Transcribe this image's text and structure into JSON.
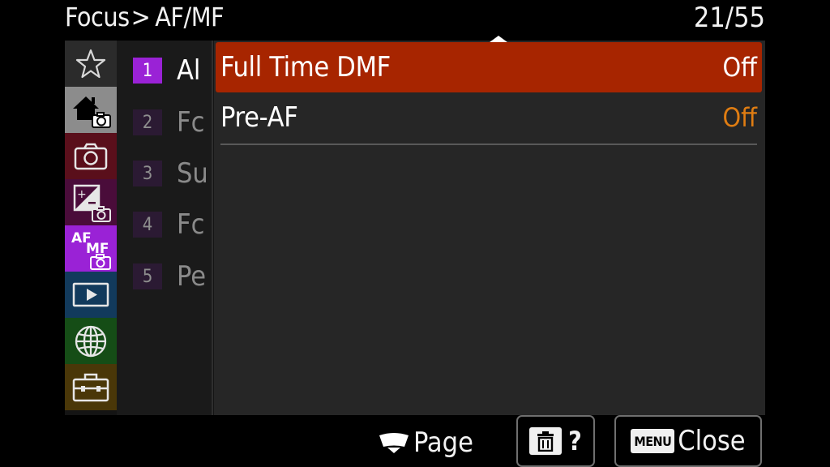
{
  "header": {
    "breadcrumb_parent": "Focus",
    "breadcrumb_separator": ">",
    "breadcrumb_current": "AF/MF",
    "page_counter": "21/55"
  },
  "categories": [
    {
      "icon": "star-icon",
      "color": "#2b2b2b",
      "selected": false
    },
    {
      "icon": "home-camera-icon",
      "color": "#8c8c8c",
      "selected": false
    },
    {
      "icon": "camera-icon",
      "color": "#5a0f1b",
      "selected": false
    },
    {
      "icon": "exposure-camera-icon",
      "color": "#4a0c3a",
      "selected": false
    },
    {
      "icon": "af-mf-camera-icon",
      "color": "#9a22d6",
      "selected": true,
      "label_af": "AF",
      "label_mf": "MF"
    },
    {
      "icon": "playback-icon",
      "color": "#123a5c",
      "selected": false
    },
    {
      "icon": "globe-icon",
      "color": "#154d16",
      "selected": false
    },
    {
      "icon": "toolbox-icon",
      "color": "#4a3708",
      "selected": false
    }
  ],
  "submenu": [
    {
      "number": "1",
      "label": "Al",
      "active": true
    },
    {
      "number": "2",
      "label": "Fc",
      "active": false
    },
    {
      "number": "3",
      "label": "Su",
      "active": false
    },
    {
      "number": "4",
      "label": "Fc",
      "active": false
    },
    {
      "number": "5",
      "label": "Pe",
      "active": false
    }
  ],
  "items": [
    {
      "label": "Full Time DMF",
      "value": "Off",
      "selected": true,
      "value_color": "#ffffff"
    },
    {
      "label": "Pre-AF",
      "value": "Off",
      "selected": false,
      "value_color": "#e07d12"
    }
  ],
  "footer": {
    "page_label": "Page",
    "help_label": "?",
    "menu_key_label": "MENU",
    "close_label": "Close"
  }
}
